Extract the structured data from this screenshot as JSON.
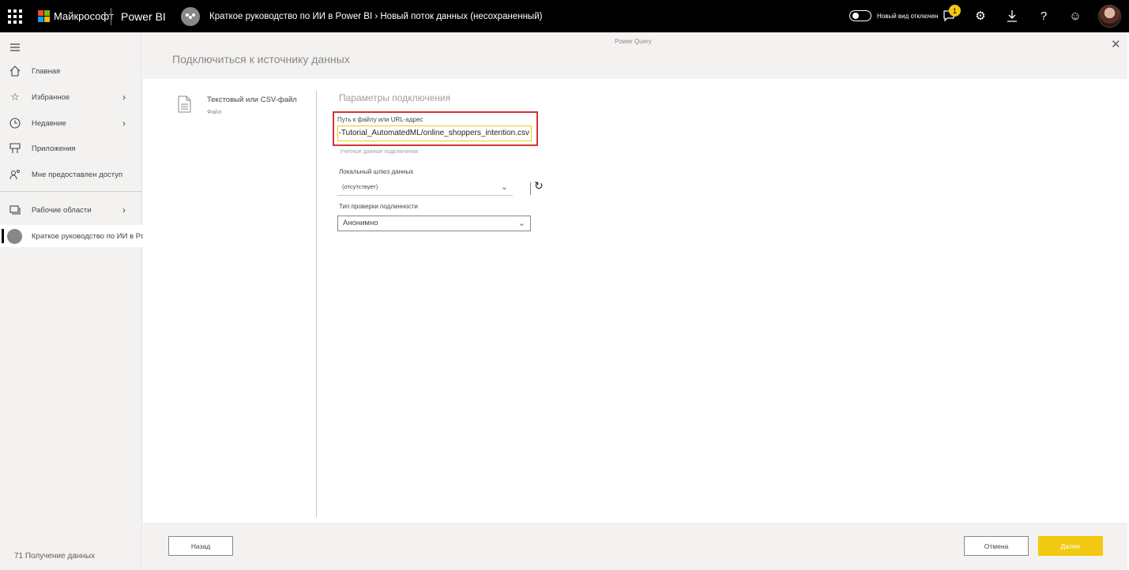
{
  "topbar": {
    "brand": "Майкрософт",
    "product": "Power BI",
    "title": "Краткое руководство по ИИ в Power BI  › Новый поток данных (несохраненный)",
    "toggle_label": "Новый вид отключен",
    "notification_count": "1",
    "help": "?",
    "brand_colors": [
      "#f25022",
      "#7fba00",
      "#00a4ef",
      "#ffb900"
    ]
  },
  "sidebar": {
    "items": [
      {
        "label": "Главная",
        "icon": "home-icon"
      },
      {
        "label": "Избранное",
        "icon": "star-icon"
      },
      {
        "label": "Недавние",
        "icon": "clock-icon"
      },
      {
        "label": "Приложения",
        "icon": "apps-icon"
      },
      {
        "label": "Мне предоставлен доступ",
        "icon": "shared-icon"
      },
      {
        "label": "Рабочие области",
        "icon": "workspaces-icon"
      },
      {
        "label": "Краткое руководство по ИИ в Power BI",
        "icon": "workspace-avatar-icon"
      }
    ],
    "footer": "71 Получение данных"
  },
  "dialog": {
    "header_label": "Power Query",
    "title": "Подключиться к источнику данных",
    "source": {
      "name": "Текстовый или CSV-файл",
      "type": "Файл"
    },
    "params_title": "Параметры подключения",
    "path_label": "Путь к файлу или URL-адрес",
    "path_value": "https://raw.githubusercontent.com/santiagxf/M-Tutorial_AutomatedML/online_shoppers_intention.csv",
    "credentials_note": "Учетные данные подключения",
    "gateway_label": "Локальный шлюз данных",
    "gateway_value": "(отсутствует)",
    "auth_label": "Тип проверки подлинности",
    "auth_value": "Анонимно",
    "back_label": "Назад",
    "cancel_label": "Отмена",
    "next_label": "Далее",
    "accent_color": "#f2c811",
    "highlight_color": "#d13438"
  }
}
